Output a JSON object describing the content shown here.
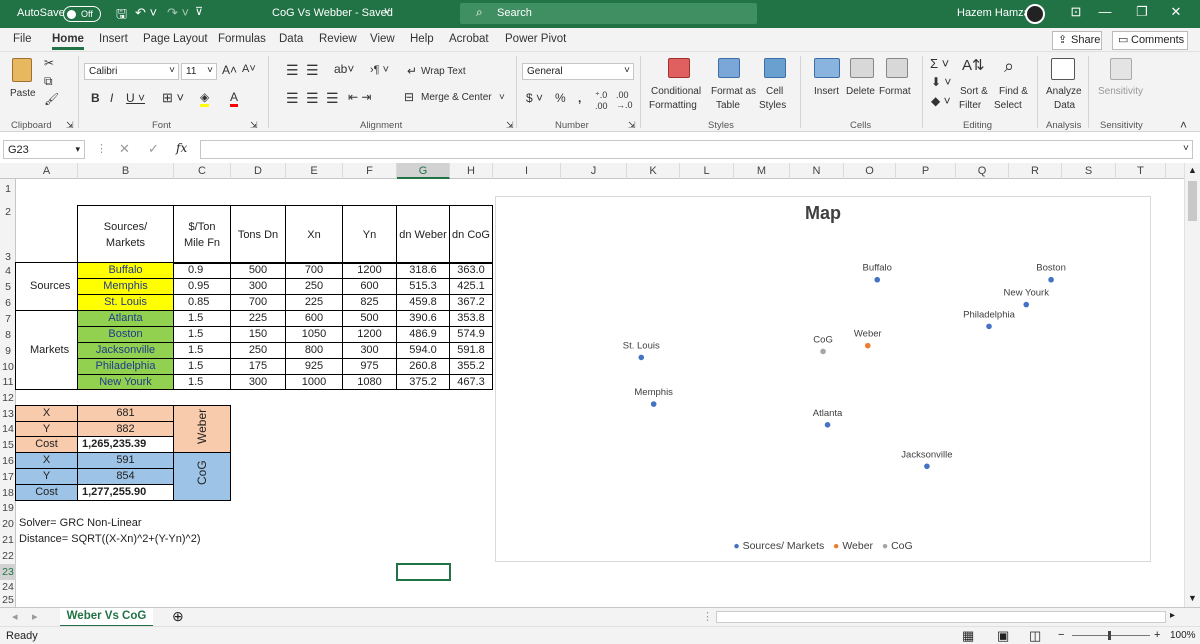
{
  "titlebar": {
    "autosave": "AutoSave",
    "toggle": "Off",
    "doc_title": "CoG Vs Webber  -  Saved",
    "search_placeholder": "Search",
    "user": "Hazem Hamza"
  },
  "menu": {
    "items": [
      "File",
      "Home",
      "Insert",
      "Page Layout",
      "Formulas",
      "Data",
      "Review",
      "View",
      "Help",
      "Acrobat",
      "Power Pivot"
    ],
    "active": "Home",
    "share": "Share",
    "comments": "Comments"
  },
  "ribbon": {
    "paste": "Paste",
    "font_name": "Calibri",
    "font_size": "11",
    "wrap_text": "Wrap Text",
    "merge_center": "Merge & Center",
    "number_format": "General",
    "conditional": "Conditional",
    "formatting": "Formatting",
    "format_as": "Format as",
    "table": "Table",
    "cell": "Cell",
    "styles_btn": "Styles",
    "insert": "Insert",
    "delete": "Delete",
    "format": "Format",
    "sort": "Sort &",
    "filter": "Filter",
    "find": "Find &",
    "select": "Select",
    "analyze": "Analyze",
    "data": "Data",
    "sensitivity": "Sensitivity",
    "groups": {
      "clipboard": "Clipboard",
      "font": "Font",
      "alignment": "Alignment",
      "number": "Number",
      "styles": "Styles",
      "cells": "Cells",
      "editing": "Editing",
      "analysis": "Analysis",
      "sensitivity": "Sensitivity"
    }
  },
  "formula_bar": {
    "name_box": "G23",
    "fx": "fx",
    "value": ""
  },
  "columns": [
    "A",
    "B",
    "C",
    "D",
    "E",
    "F",
    "G",
    "H",
    "I",
    "J",
    "K",
    "L",
    "M",
    "N",
    "O",
    "P",
    "Q",
    "R",
    "S",
    "T"
  ],
  "selected_column": "G",
  "rows": [
    "1",
    "2",
    "3",
    "4",
    "5",
    "6",
    "7",
    "8",
    "9",
    "10",
    "11",
    "12",
    "13",
    "14",
    "15",
    "16",
    "17",
    "18",
    "19",
    "20",
    "21",
    "22",
    "23",
    "24",
    "25"
  ],
  "selected_row": "23",
  "table": {
    "headers": {
      "src_markets": "Sources/\nMarkets",
      "rate": "$/Ton\nMile Fn",
      "tons": "Tons Dn",
      "xn": "Xn",
      "yn": "Yn",
      "dn_weber": "dn Weber",
      "dn_cog": "dn     CoG"
    },
    "sources_label": "Sources",
    "markets_label": "Markets",
    "rows": [
      {
        "name": "Buffalo",
        "rate": "0.9",
        "tons": "500",
        "x": "700",
        "y": "1200",
        "w": "318.6",
        "c": "363.0"
      },
      {
        "name": "Memphis",
        "rate": "0.95",
        "tons": "300",
        "x": "250",
        "y": "600",
        "w": "515.3",
        "c": "425.1"
      },
      {
        "name": "St. Louis",
        "rate": "0.85",
        "tons": "700",
        "x": "225",
        "y": "825",
        "w": "459.8",
        "c": "367.2"
      },
      {
        "name": "Atlanta",
        "rate": "1.5",
        "tons": "225",
        "x": "600",
        "y": "500",
        "w": "390.6",
        "c": "353.8"
      },
      {
        "name": "Boston",
        "rate": "1.5",
        "tons": "150",
        "x": "1050",
        "y": "1200",
        "w": "486.9",
        "c": "574.9"
      },
      {
        "name": "Jacksonville",
        "rate": "1.5",
        "tons": "250",
        "x": "800",
        "y": "300",
        "w": "594.0",
        "c": "591.8"
      },
      {
        "name": "Philadelphia",
        "rate": "1.5",
        "tons": "175",
        "x": "925",
        "y": "975",
        "w": "260.8",
        "c": "355.2"
      },
      {
        "name": "New Yourk",
        "rate": "1.5",
        "tons": "300",
        "x": "1000",
        "y": "1080",
        "w": "375.2",
        "c": "467.3"
      }
    ]
  },
  "weber": {
    "label": "Weber",
    "x_label": "X",
    "x": "681",
    "y_label": "Y",
    "y": "882",
    "cost_label": "Cost",
    "cost": "1,265,235.39"
  },
  "cog": {
    "label": "CoG",
    "x_label": "X",
    "x": "591",
    "y_label": "Y",
    "y": "854",
    "cost_label": "Cost",
    "cost": "1,277,255.90"
  },
  "notes": {
    "solver": "Solver= GRC Non-Linear",
    "distance": "Distance= SQRT((X-Xn)^2+(Y-Yn)^2)"
  },
  "chart_data": {
    "type": "scatter",
    "title": "Map",
    "xlim": [
      150,
      1080
    ],
    "ylim": [
      200,
      1300
    ],
    "grid": false,
    "legend": "bottom",
    "series": [
      {
        "name": "Sources/ Markets",
        "color": "#4472c4",
        "points": [
          {
            "label": "Buffalo",
            "x": 700,
            "y": 1200
          },
          {
            "label": "Memphis",
            "x": 250,
            "y": 600
          },
          {
            "label": "St. Louis",
            "x": 225,
            "y": 825
          },
          {
            "label": "Atlanta",
            "x": 600,
            "y": 500
          },
          {
            "label": "Boston",
            "x": 1050,
            "y": 1200
          },
          {
            "label": "Jacksonville",
            "x": 800,
            "y": 300
          },
          {
            "label": "Philadelphia",
            "x": 925,
            "y": 975
          },
          {
            "label": "New Yourk",
            "x": 1000,
            "y": 1080
          }
        ]
      },
      {
        "name": "Weber",
        "color": "#ed7d31",
        "points": [
          {
            "label": "Weber",
            "x": 681,
            "y": 882
          }
        ]
      },
      {
        "name": "CoG",
        "color": "#a5a5a5",
        "points": [
          {
            "label": "CoG",
            "x": 591,
            "y": 854
          }
        ]
      }
    ]
  },
  "sheet_tab": "Weber Vs CoG",
  "status": {
    "ready": "Ready",
    "zoom": "100%"
  }
}
